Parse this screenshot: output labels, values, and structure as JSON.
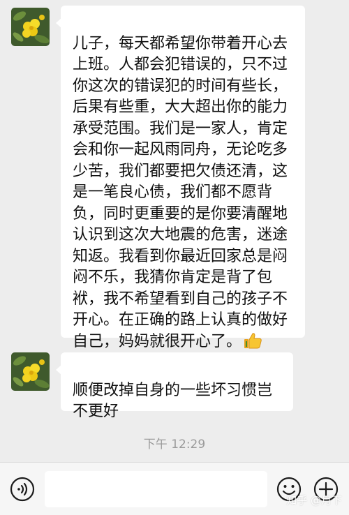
{
  "messages": [
    {
      "sender_avatar": "flower-avatar",
      "text": "儿子，每天都希望你带着开心去上班。人都会犯错误的，只不过你这次的错误犯的时间有些长，后果有些重，大大超出你的能力承受范围。我们是一家人，肯定会和你一起风雨同舟，无论吃多少苦，我们都要把欠债还清，这是一笔良心债，我们都不愿背负，同时更重要的是你要清醒地认识到这次大地震的危害，迷途知返。我看到你最近回家总是闷闷不乐，我猜你肯定是背了包袱，我不希望看到自己的孩子不开心。在正确的路上认真的做好自己，妈妈就很开心了。",
      "emoji": "thumbs-up-icon"
    },
    {
      "sender_avatar": "flower-avatar",
      "text": "顺便改掉自身的一些坏习惯岂不更好"
    }
  ],
  "timestamp": "下午 12:29",
  "input_bar": {
    "voice_icon": "voice-icon",
    "text_value": "",
    "emoji_icon": "emoji-icon",
    "plus_icon": "plus-icon"
  },
  "watermark": "知乎 @月下",
  "colors": {
    "background": "#ededed",
    "bubble": "#ffffff",
    "bar": "#f6f6f6"
  }
}
